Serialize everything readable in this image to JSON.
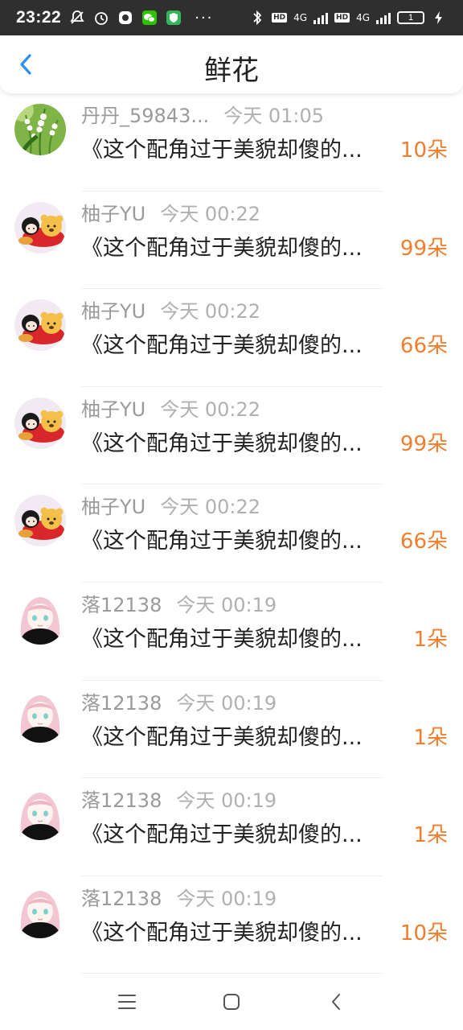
{
  "status_bar": {
    "time": "23:22",
    "network_1": "4G",
    "network_2": "4G",
    "hd_1": "HD",
    "hd_2": "HD",
    "battery": "1",
    "more": "···"
  },
  "header": {
    "title": "鲜花"
  },
  "items": [
    {
      "name": "丹丹_59843...",
      "time": "今天 01:05",
      "message": "《这个配角过于美貌却傻的...",
      "count": "10朵",
      "avatar": "lily-of-the-valley"
    },
    {
      "name": "柚子YU",
      "time": "今天 00:22",
      "message": "《这个配角过于美貌却傻的...",
      "count": "99朵",
      "avatar": "girl-with-bear"
    },
    {
      "name": "柚子YU",
      "time": "今天 00:22",
      "message": "《这个配角过于美貌却傻的...",
      "count": "66朵",
      "avatar": "girl-with-bear"
    },
    {
      "name": "柚子YU",
      "time": "今天 00:22",
      "message": "《这个配角过于美貌却傻的...",
      "count": "99朵",
      "avatar": "girl-with-bear"
    },
    {
      "name": "柚子YU",
      "time": "今天 00:22",
      "message": "《这个配角过于美貌却傻的...",
      "count": "66朵",
      "avatar": "girl-with-bear"
    },
    {
      "name": "落12138",
      "time": "今天 00:19",
      "message": "《这个配角过于美貌却傻的...",
      "count": "1朵",
      "avatar": "pink-hair-girl"
    },
    {
      "name": "落12138",
      "time": "今天 00:19",
      "message": "《这个配角过于美貌却傻的...",
      "count": "1朵",
      "avatar": "pink-hair-girl"
    },
    {
      "name": "落12138",
      "time": "今天 00:19",
      "message": "《这个配角过于美貌却傻的...",
      "count": "1朵",
      "avatar": "pink-hair-girl"
    },
    {
      "name": "落12138",
      "time": "今天 00:19",
      "message": "《这个配角过于美貌却傻的...",
      "count": "10朵",
      "avatar": "pink-hair-girl"
    }
  ],
  "colors": {
    "accent": "#2a8ff0",
    "count": "#f07e2e",
    "status_bar": "#2f2f2f"
  }
}
